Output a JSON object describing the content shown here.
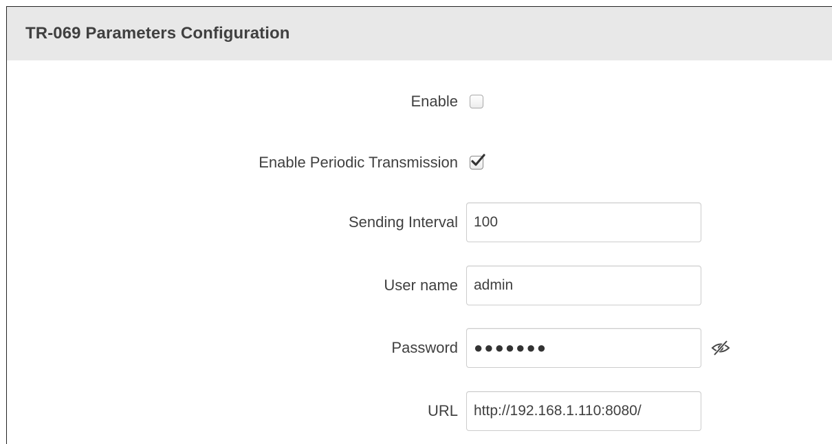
{
  "panel": {
    "title": "TR-069 Parameters Configuration"
  },
  "fields": {
    "enable": {
      "label": "Enable",
      "checked": false
    },
    "periodic": {
      "label": "Enable Periodic Transmission",
      "checked": true
    },
    "interval": {
      "label": "Sending Interval",
      "value": "100"
    },
    "username": {
      "label": "User name",
      "value": "admin"
    },
    "password": {
      "label": "Password",
      "masked": "●●●●●●●",
      "toggle_icon": "eye-slash-icon"
    },
    "url": {
      "label": "URL",
      "value": "http://192.168.1.110:8080/"
    }
  },
  "colors": {
    "header_bg": "#e8e8e8",
    "text": "#404040",
    "input_border": "#cccccc"
  }
}
